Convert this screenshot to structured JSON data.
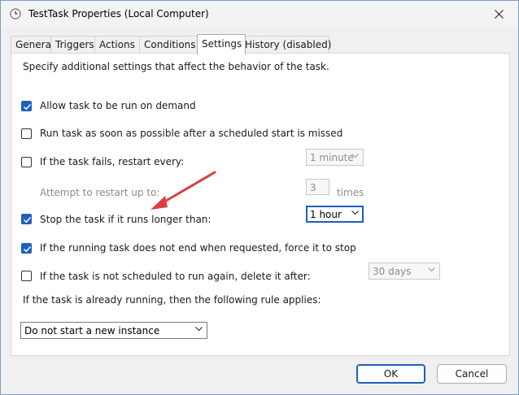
{
  "window": {
    "title": "TestTask Properties (Local Computer)"
  },
  "tabs": [
    {
      "label": "General"
    },
    {
      "label": "Triggers"
    },
    {
      "label": "Actions"
    },
    {
      "label": "Conditions"
    },
    {
      "label": "Settings"
    },
    {
      "label": "History (disabled)"
    }
  ],
  "active_tab": "Settings",
  "settings": {
    "description": "Specify additional settings that affect the behavior of the task.",
    "allow_on_demand": {
      "label": "Allow task to be run on demand",
      "checked": true
    },
    "run_asap": {
      "label": "Run task as soon as possible after a scheduled start is missed",
      "checked": false
    },
    "restart_on_fail": {
      "label": "If the task fails, restart every:",
      "checked": false,
      "value": "1 minute"
    },
    "attempt_restart": {
      "label": "Attempt to restart up to:",
      "value": "3",
      "unit": "times"
    },
    "stop_if_longer": {
      "label": "Stop the task if it runs longer than:",
      "checked": true,
      "value": "1 hour"
    },
    "force_stop": {
      "label": "If the running task does not end when requested, force it to stop",
      "checked": true
    },
    "delete_after": {
      "label": "If the task is not scheduled to run again, delete it after:",
      "checked": false,
      "value": "30 days"
    },
    "running_rule": {
      "label": "If the task is already running, then the following rule applies:",
      "value": "Do not start a new instance"
    }
  },
  "buttons": {
    "ok": "OK",
    "cancel": "Cancel"
  },
  "annotation": {
    "arrow_color": "#d94040"
  }
}
